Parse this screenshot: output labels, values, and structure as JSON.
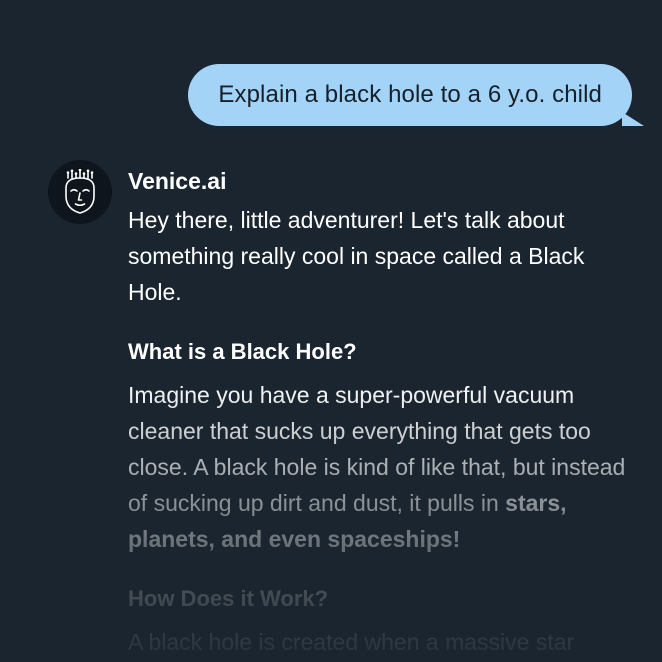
{
  "user_message": {
    "text": "Explain a black hole to a 6 y.o. child"
  },
  "assistant": {
    "name": "Venice.ai",
    "avatar_icon": "venice-mask-icon",
    "intro": "Hey there, little adventurer! Let's talk about something really cool in space called a Black Hole.",
    "section1_heading": "What is a Black Hole?",
    "section1_text": "Imagine you have a super-powerful vacuum cleaner that sucks up everything that gets too close. A black hole is kind of like that, but instead of sucking up dirt and dust, it pulls in ",
    "section1_emphasis": "stars, planets, and even spaceships!",
    "section2_heading": "How Does it Work?",
    "section2_text": "A black hole is created when a massive star"
  },
  "colors": {
    "background": "#1b252f",
    "user_bubble": "#a3d4f7",
    "user_text": "#16202a",
    "assistant_text": "#ffffff",
    "avatar_bg": "#0e151c"
  }
}
